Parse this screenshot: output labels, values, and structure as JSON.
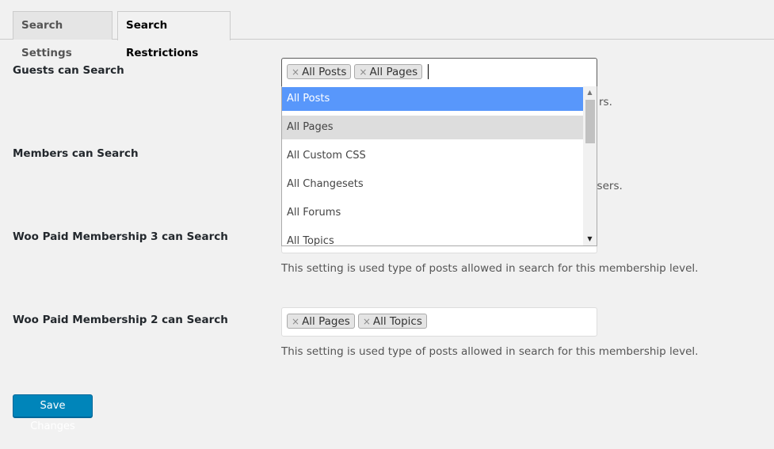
{
  "tabs": [
    {
      "label": "Search Settings",
      "active": false
    },
    {
      "label": "Search Restrictions",
      "active": true
    }
  ],
  "rows": [
    {
      "label": "Guests can Search",
      "selected": [
        "All Posts",
        "All Pages"
      ],
      "description": "rs."
    },
    {
      "label": "Members can Search",
      "selected": [],
      "description": "users."
    },
    {
      "label": "Woo Paid Membership 3 can Search",
      "selected": [],
      "description": "This setting is used type of posts allowed in search for this membership level."
    },
    {
      "label": "Woo Paid Membership 2 can Search",
      "selected": [
        "All Pages",
        "All Topics"
      ],
      "description": "This setting is used type of posts allowed in search for this membership level."
    }
  ],
  "dropdown": {
    "options": [
      "All Posts",
      "All Pages",
      "All Custom CSS",
      "All Changesets",
      "All Forums",
      "All Topics"
    ],
    "highlighted": "All Posts",
    "selected": [
      "All Posts",
      "All Pages"
    ]
  },
  "remove_glyph": "×",
  "save_label": "Save Changes",
  "colors": {
    "highlight": "#5897fb",
    "button": "#0085ba",
    "background": "#f1f1f1"
  }
}
